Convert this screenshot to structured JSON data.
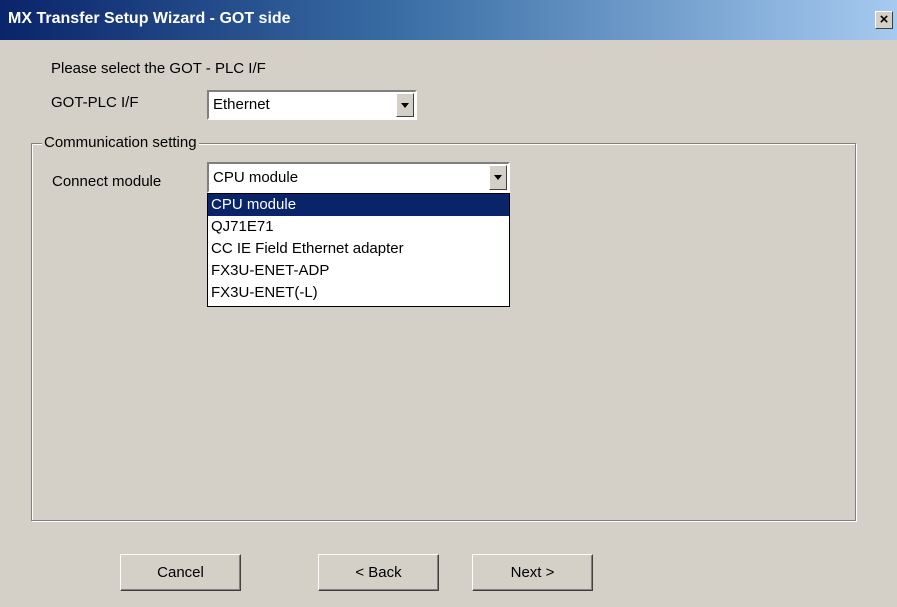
{
  "window": {
    "title": "MX Transfer Setup Wizard - GOT side",
    "close_label": "×"
  },
  "instruction": "Please select the GOT - PLC I/F",
  "got_plc_if": {
    "label": "GOT-PLC I/F",
    "value": "Ethernet"
  },
  "communication_setting": {
    "legend": "Communication setting",
    "connect_module": {
      "label": "Connect module",
      "value": "CPU module",
      "options": [
        "CPU module",
        "QJ71E71",
        "CC IE Field Ethernet adapter",
        "FX3U-ENET-ADP",
        "FX3U-ENET(-L)"
      ],
      "highlighted_index": 0
    }
  },
  "buttons": {
    "cancel": "Cancel",
    "back": "< Back",
    "next": "Next >"
  },
  "colors": {
    "dialog_background": "#d4d0c8",
    "titlebar_start": "#0a246a",
    "titlebar_end": "#a6caf0",
    "selection": "#0a246a"
  },
  "icons": {
    "close": "close-icon",
    "dropdown": "chevron-down-icon"
  }
}
